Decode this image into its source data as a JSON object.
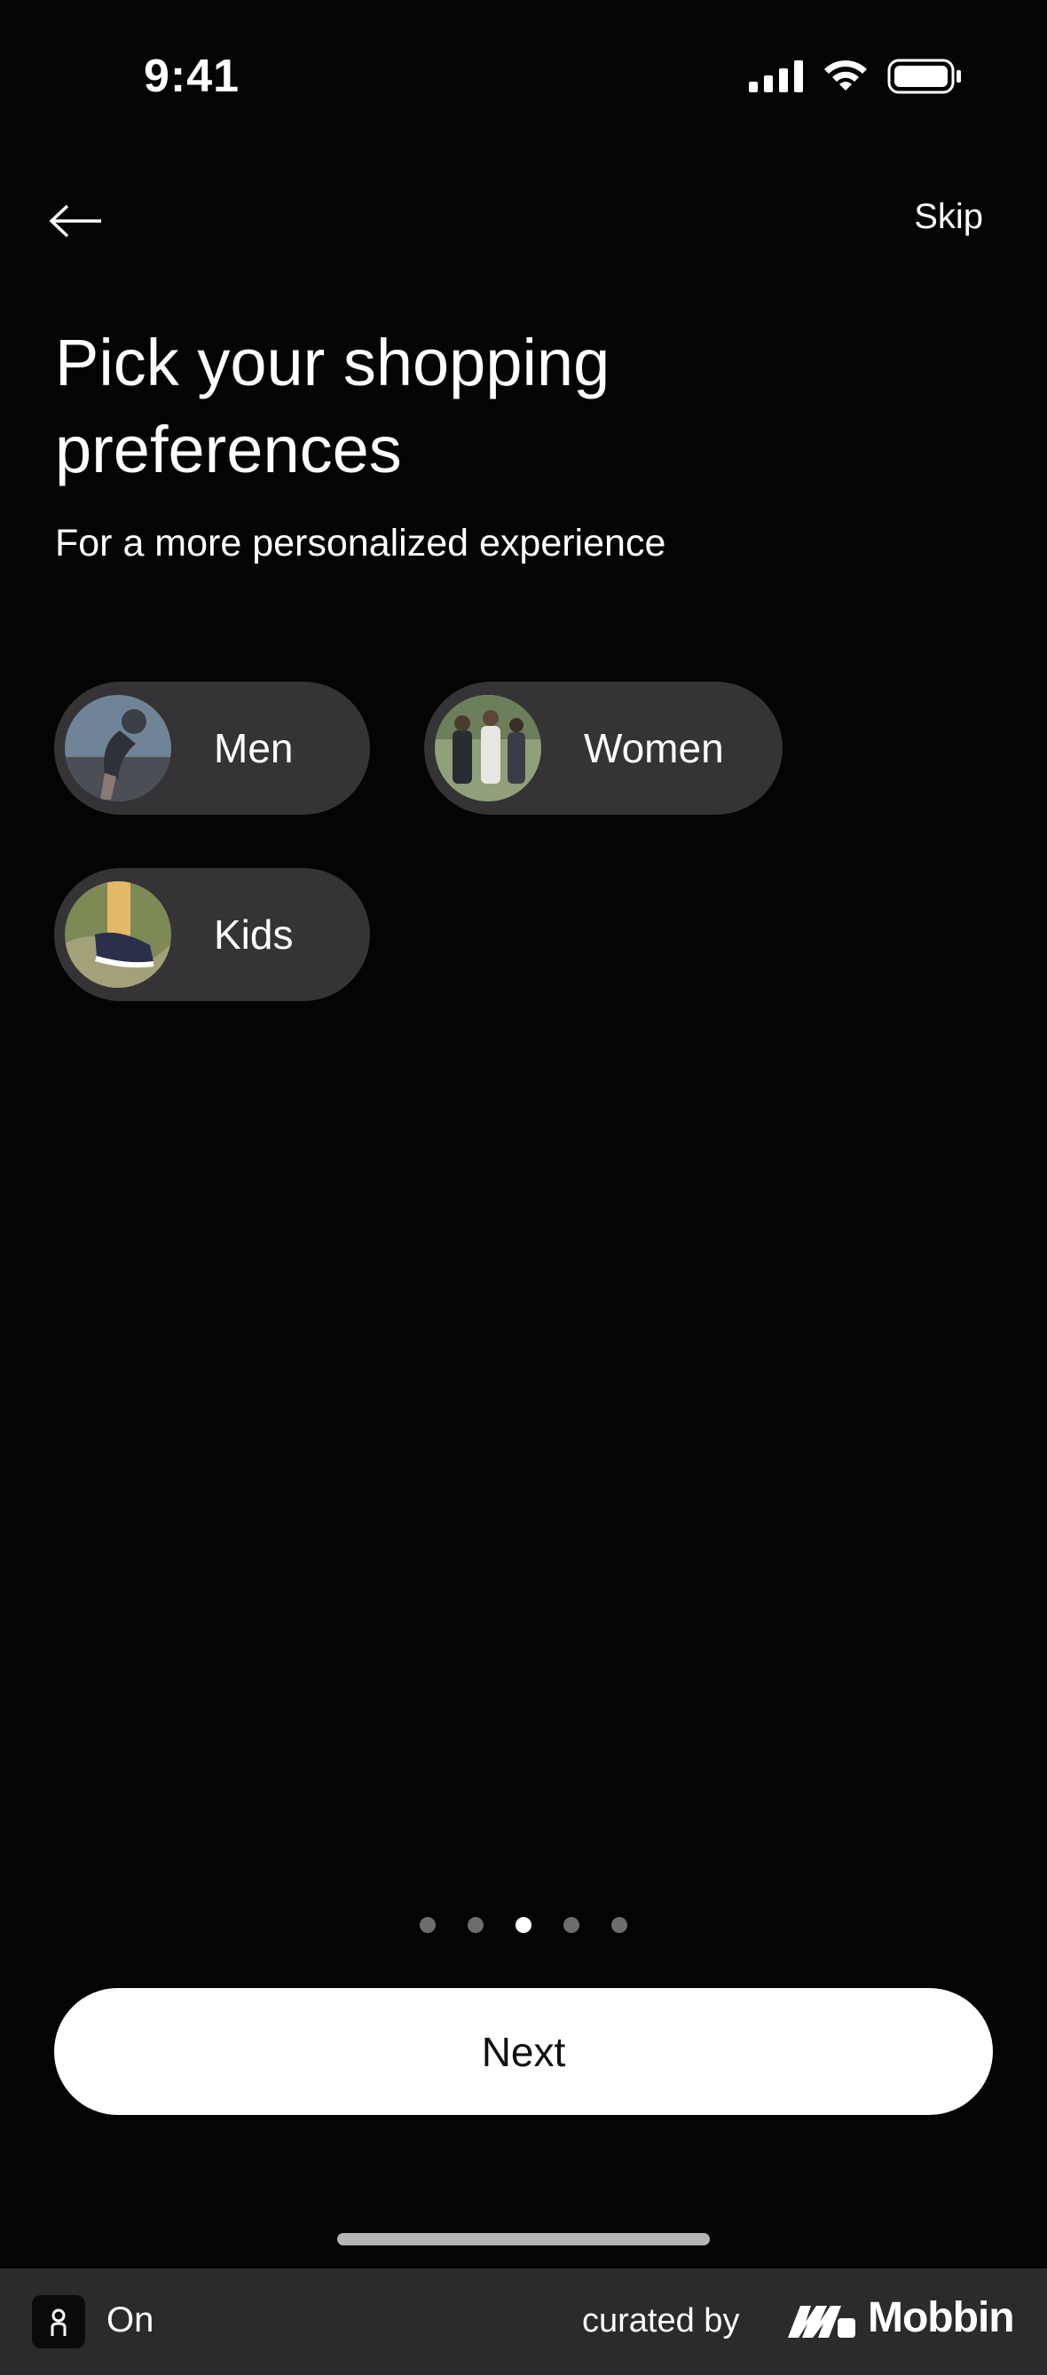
{
  "status_bar": {
    "time": "9:41"
  },
  "nav": {
    "back_icon": "arrow-left-icon",
    "skip_label": "Skip"
  },
  "header": {
    "title": "Pick your shopping preferences",
    "subtitle": "For a more personalized experience"
  },
  "preferences": [
    {
      "label": "Men",
      "selected": false
    },
    {
      "label": "Women",
      "selected": false
    },
    {
      "label": "Kids",
      "selected": false
    }
  ],
  "pagination": {
    "total": 5,
    "current": 3
  },
  "next_button": {
    "label": "Next"
  },
  "footer": {
    "on_label": "On",
    "curated_label": "curated by",
    "brand": "Mobbin"
  },
  "colors": {
    "background": "#050405",
    "chip": "#353335",
    "button": "#ffffff",
    "footer": "#2b2a2c"
  }
}
